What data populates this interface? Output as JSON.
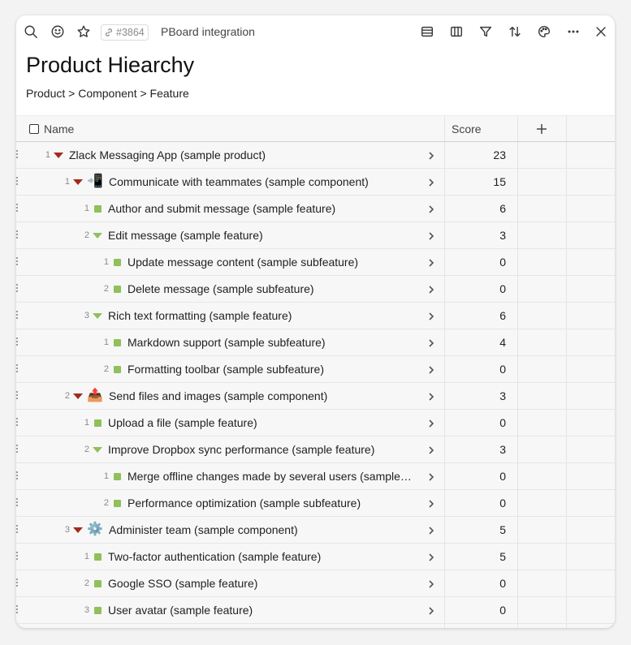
{
  "toolbar": {
    "id_label": "#3864",
    "title": "PBoard integration",
    "icons": [
      "search-icon",
      "emoji-icon",
      "star-icon",
      "link-icon",
      "table-view-icon",
      "columns-icon",
      "filter-icon",
      "sort-icon",
      "palette-icon",
      "more-icon",
      "close-icon"
    ]
  },
  "page": {
    "title": "Product Hiearchy",
    "subtitle": "Product > Component > Feature"
  },
  "table": {
    "headers": {
      "name": "Name",
      "score": "Score"
    },
    "rows": [
      {
        "num": "1",
        "level": 0,
        "marker": "red-triangle",
        "emoji": "",
        "name": "Zlack Messaging App (sample product)",
        "score": "23"
      },
      {
        "num": "1",
        "level": 1,
        "marker": "red-triangle",
        "emoji": "📲",
        "name": "Communicate with teammates (sample component)",
        "score": "15"
      },
      {
        "num": "1",
        "level": 2,
        "marker": "green-square",
        "emoji": "",
        "name": "Author and submit message (sample feature)",
        "score": "6"
      },
      {
        "num": "2",
        "level": 2,
        "marker": "green-triangle",
        "emoji": "",
        "name": "Edit message (sample feature)",
        "score": "3"
      },
      {
        "num": "1",
        "level": 3,
        "marker": "green-square",
        "emoji": "",
        "name": "Update message content (sample subfeature)",
        "score": "0"
      },
      {
        "num": "2",
        "level": 3,
        "marker": "green-square",
        "emoji": "",
        "name": "Delete message (sample subfeature)",
        "score": "0"
      },
      {
        "num": "3",
        "level": 2,
        "marker": "green-triangle",
        "emoji": "",
        "name": "Rich text formatting (sample feature)",
        "score": "6"
      },
      {
        "num": "1",
        "level": 3,
        "marker": "green-square",
        "emoji": "",
        "name": "Markdown support (sample subfeature)",
        "score": "4"
      },
      {
        "num": "2",
        "level": 3,
        "marker": "green-square",
        "emoji": "",
        "name": "Formatting toolbar (sample subfeature)",
        "score": "0"
      },
      {
        "num": "2",
        "level": 1,
        "marker": "red-triangle",
        "emoji": "📤",
        "name": "Send files and images (sample component)",
        "score": "3"
      },
      {
        "num": "1",
        "level": 2,
        "marker": "green-square",
        "emoji": "",
        "name": "Upload a file (sample feature)",
        "score": "0"
      },
      {
        "num": "2",
        "level": 2,
        "marker": "green-triangle",
        "emoji": "",
        "name": "Improve Dropbox sync performance (sample feature)",
        "score": "3"
      },
      {
        "num": "1",
        "level": 3,
        "marker": "green-square",
        "emoji": "",
        "name": "Merge offline changes made by several users (sample…",
        "score": "0"
      },
      {
        "num": "2",
        "level": 3,
        "marker": "green-square",
        "emoji": "",
        "name": "Performance optimization (sample subfeature)",
        "score": "0"
      },
      {
        "num": "3",
        "level": 1,
        "marker": "red-triangle",
        "emoji": "⚙️",
        "name": "Administer team (sample component)",
        "score": "5"
      },
      {
        "num": "1",
        "level": 2,
        "marker": "green-square",
        "emoji": "",
        "name": "Two-factor authentication (sample feature)",
        "score": "5"
      },
      {
        "num": "2",
        "level": 2,
        "marker": "green-square",
        "emoji": "",
        "name": "Google SSO (sample feature)",
        "score": "0"
      },
      {
        "num": "3",
        "level": 2,
        "marker": "green-square",
        "emoji": "",
        "name": "User avatar (sample feature)",
        "score": "0"
      }
    ]
  },
  "colors": {
    "product_marker": "#a32a1f",
    "feature_marker": "#8fc05a"
  }
}
